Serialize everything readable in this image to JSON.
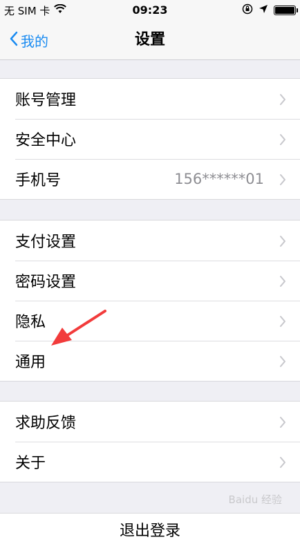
{
  "status_bar": {
    "carrier": "无 SIM 卡",
    "time": "09:23",
    "icons": [
      "wifi-icon",
      "orientation-lock-icon",
      "location-icon",
      "battery-icon"
    ],
    "battery_level": 1.0
  },
  "nav": {
    "back_label": "我的",
    "title": "设置"
  },
  "groups": [
    {
      "rows": [
        {
          "label": "账号管理"
        },
        {
          "label": "安全中心"
        },
        {
          "label": "手机号",
          "value": "156******01"
        }
      ]
    },
    {
      "rows": [
        {
          "label": "支付设置"
        },
        {
          "label": "密码设置"
        },
        {
          "label": "隐私"
        },
        {
          "label": "通用"
        }
      ]
    },
    {
      "rows": [
        {
          "label": "求助反馈"
        },
        {
          "label": "关于"
        }
      ]
    }
  ],
  "logout_label": "退出登录",
  "annotation": {
    "icon": "red-arrow-annotation",
    "color": "#f23b3b"
  },
  "watermark": "Baidu 经验",
  "colors": {
    "accent": "#1a8bf1",
    "background": "#efeff4"
  }
}
